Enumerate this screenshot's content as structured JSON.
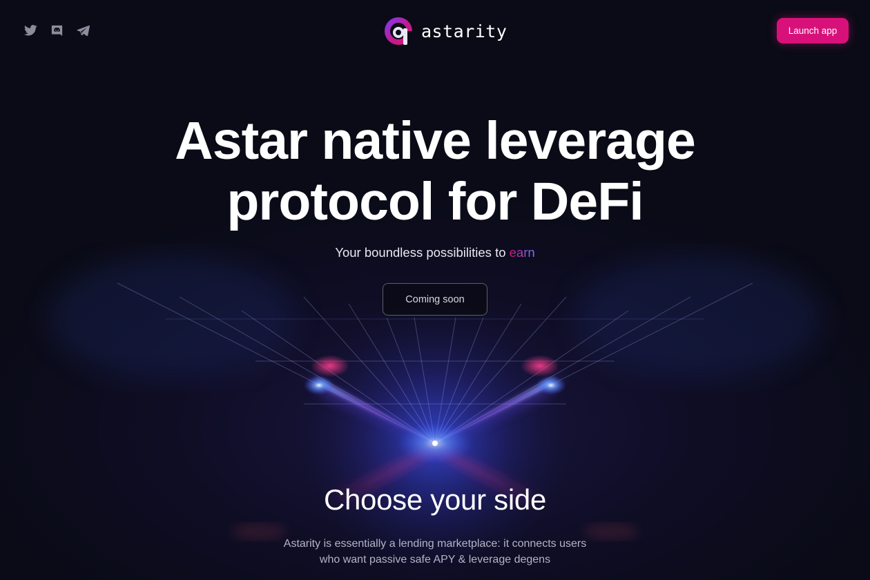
{
  "header": {
    "socials": [
      {
        "icon": "twitter-icon"
      },
      {
        "icon": "discord-icon"
      },
      {
        "icon": "telegram-icon"
      }
    ],
    "logo_text": "astarity",
    "launch_label": "Launch app"
  },
  "hero": {
    "title_line1": "Astar native leverage",
    "title_line2": "protocol for DeFi",
    "subtitle_prefix": "Your boundless possibilities to",
    "subtitle_highlight": "earn",
    "cta_label": "Coming soon"
  },
  "section": {
    "title": "Choose your side",
    "desc_line1": "Astarity is essentially a lending marketplace: it connects users",
    "desc_line2": "who want passive safe APY & leverage degens"
  },
  "colors": {
    "background": "#0a0b16",
    "accent_pink": "#d8117a",
    "accent_blue": "#6a7dff",
    "icon_gray": "#8a8d9c"
  }
}
